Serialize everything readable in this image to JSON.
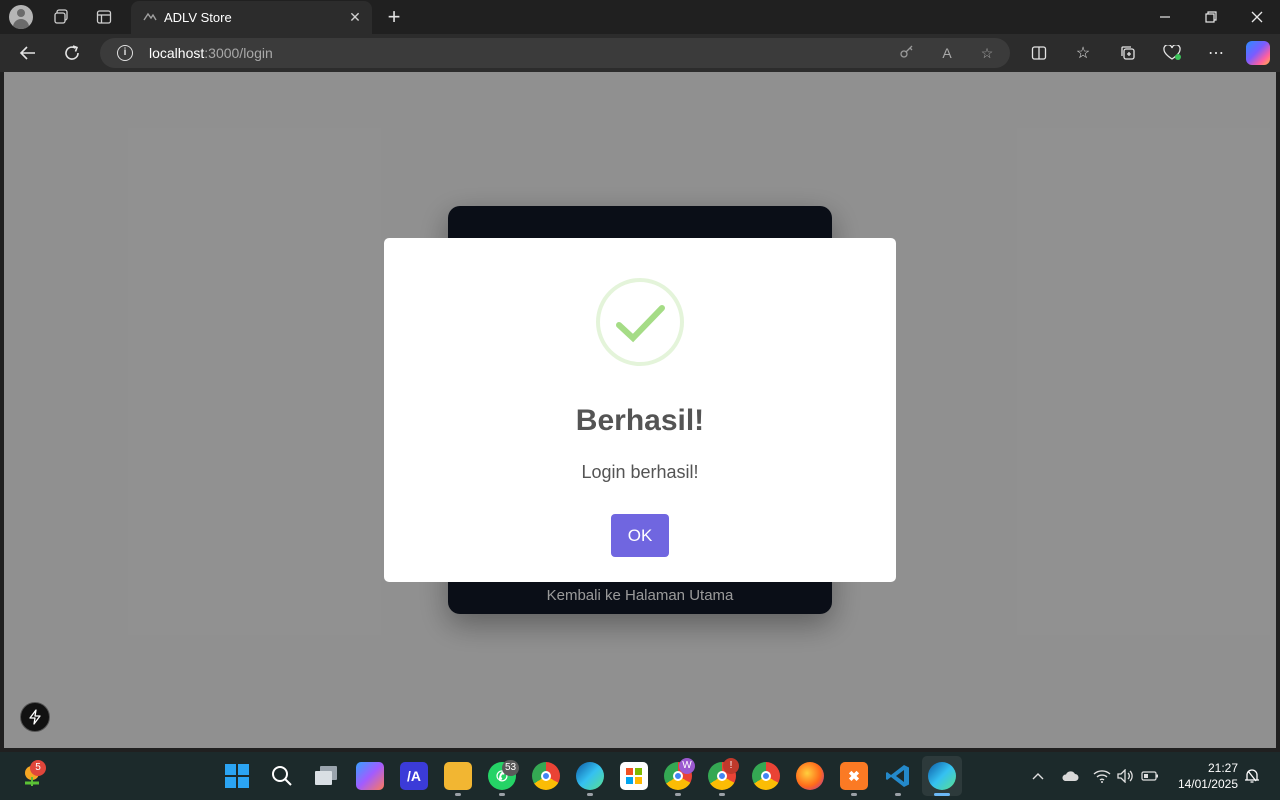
{
  "browser": {
    "tab_title": "ADLV Store",
    "url_host": "localhost",
    "url_path": ":3000/login"
  },
  "page": {
    "back_link": "Kembali ke Halaman Utama"
  },
  "modal": {
    "title": "Berhasil!",
    "message": "Login berhasil!",
    "ok_label": "OK",
    "accent_color": "#7066e0",
    "success_color": "#a5dc86"
  },
  "taskbar": {
    "widgets_badge": "5",
    "whatsapp_badge": "53",
    "chrome_profile_badge": "W",
    "chrome_alert_badge": "!",
    "time": "21:27",
    "date": "14/01/2025"
  }
}
